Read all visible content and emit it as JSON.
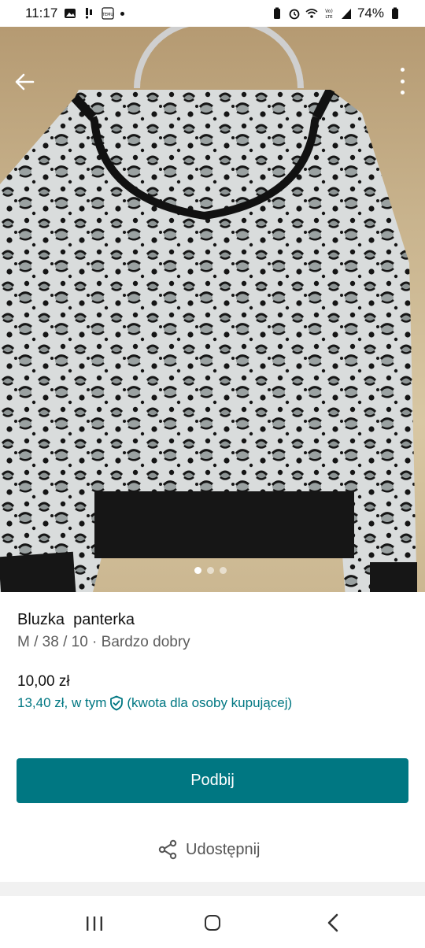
{
  "status_bar": {
    "time": "11:17",
    "battery_percent": "74%",
    "icons_left": [
      "gallery-icon",
      "notification-icon",
      "temu-icon",
      "dot"
    ],
    "icons_right": [
      "battery-saver-icon",
      "alarm-icon",
      "wifi-icon",
      "volte-icon",
      "signal-icon",
      "battery-icon"
    ]
  },
  "photo": {
    "image_count": 3,
    "active_index": 0
  },
  "item": {
    "title": "Bluzka  panterka",
    "details": "M / 38 / 10 · Bardzo dobry",
    "price": "10,00 zł",
    "buyer_price": "13,40 zł, w tym",
    "buyer_note": "(kwota dla osoby kupującej)"
  },
  "actions": {
    "bump_label": "Podbij",
    "share_label": "Udostępnij"
  },
  "colors": {
    "accent": "#007782",
    "text": "#111111",
    "secondary_text": "#5d5d5d"
  }
}
